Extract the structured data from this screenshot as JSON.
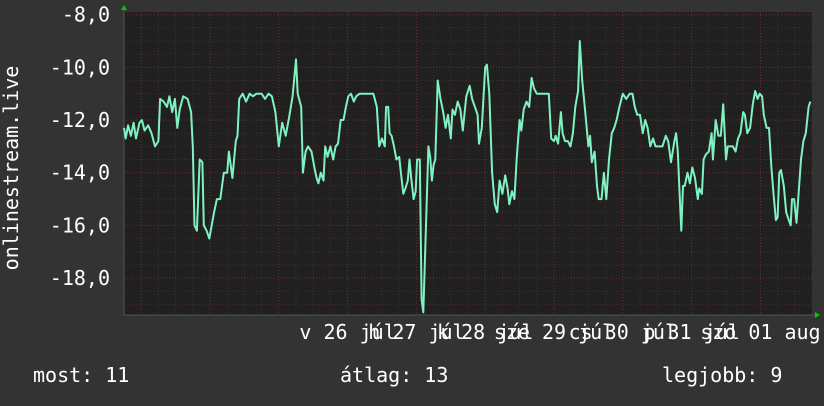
{
  "chart_data": {
    "type": "line",
    "ylabel": "onlinestream.live",
    "ylim": [
      -19.4,
      -7.9
    ],
    "y_ticks": [
      {
        "value": -8.0,
        "label": "-8,0"
      },
      {
        "value": -10.0,
        "label": "-10,0"
      },
      {
        "value": -12.0,
        "label": "-12,0"
      },
      {
        "value": -14.0,
        "label": "-14,0"
      },
      {
        "value": -16.0,
        "label": "-16,0"
      },
      {
        "value": -18.0,
        "label": "-18,0"
      }
    ],
    "x_tick_labels": [
      {
        "text": "v 26 júl",
        "x": 6.5
      },
      {
        "text": "h 27 júl",
        "x": 8.5
      },
      {
        "text": "k 28 júl",
        "x": 10.5
      },
      {
        "text": "sze 29 júl",
        "x": 12.5
      },
      {
        "text": "cs 30 júl",
        "x": 14.5
      },
      {
        "text": "p 31 júl",
        "x": 16.5
      },
      {
        "text": "szo 01 aug",
        "x": 18.5
      }
    ],
    "x_range": [
      0,
      20
    ],
    "grid": true,
    "colors": {
      "background": "#333333",
      "plot_bg": "#202020",
      "line": "#7ff2c2",
      "grid_minor": "#4a2a2a",
      "grid_major": "#6a2f2f",
      "axis_arrow": "#00cc00",
      "text": "#ffffff"
    },
    "series": [
      {
        "values": [
          [
            0.0,
            -12.3
          ],
          [
            0.05,
            -12.7
          ],
          [
            0.12,
            -12.2
          ],
          [
            0.2,
            -12.6
          ],
          [
            0.28,
            -12.1
          ],
          [
            0.35,
            -12.7
          ],
          [
            0.45,
            -12.1
          ],
          [
            0.52,
            -12.0
          ],
          [
            0.6,
            -12.4
          ],
          [
            0.7,
            -12.2
          ],
          [
            0.8,
            -12.5
          ],
          [
            0.9,
            -13.0
          ],
          [
            1.0,
            -12.8
          ],
          [
            1.05,
            -11.2
          ],
          [
            1.15,
            -11.3
          ],
          [
            1.25,
            -11.5
          ],
          [
            1.32,
            -11.1
          ],
          [
            1.4,
            -11.7
          ],
          [
            1.48,
            -11.2
          ],
          [
            1.55,
            -12.3
          ],
          [
            1.62,
            -11.6
          ],
          [
            1.72,
            -11.1
          ],
          [
            1.85,
            -11.2
          ],
          [
            1.95,
            -11.7
          ],
          [
            2.0,
            -13.0
          ],
          [
            2.05,
            -16.0
          ],
          [
            2.12,
            -16.2
          ],
          [
            2.2,
            -13.5
          ],
          [
            2.28,
            -13.6
          ],
          [
            2.32,
            -16.0
          ],
          [
            2.4,
            -16.2
          ],
          [
            2.48,
            -16.5
          ],
          [
            2.55,
            -16.0
          ],
          [
            2.62,
            -15.5
          ],
          [
            2.7,
            -15.0
          ],
          [
            2.8,
            -15.0
          ],
          [
            2.9,
            -14.0
          ],
          [
            3.0,
            -14.0
          ],
          [
            3.05,
            -13.2
          ],
          [
            3.15,
            -14.2
          ],
          [
            3.25,
            -12.8
          ],
          [
            3.3,
            -12.6
          ],
          [
            3.35,
            -11.2
          ],
          [
            3.45,
            -11.0
          ],
          [
            3.55,
            -11.3
          ],
          [
            3.65,
            -11.0
          ],
          [
            3.75,
            -11.1
          ],
          [
            3.85,
            -11.0
          ],
          [
            4.0,
            -11.0
          ],
          [
            4.1,
            -11.2
          ],
          [
            4.2,
            -11.0
          ],
          [
            4.3,
            -11.1
          ],
          [
            4.4,
            -11.7
          ],
          [
            4.5,
            -13.0
          ],
          [
            4.6,
            -12.1
          ],
          [
            4.7,
            -12.6
          ],
          [
            4.8,
            -11.9
          ],
          [
            4.9,
            -11.1
          ],
          [
            5.0,
            -9.7
          ],
          [
            5.05,
            -11.0
          ],
          [
            5.15,
            -11.5
          ],
          [
            5.2,
            -14.0
          ],
          [
            5.28,
            -13.2
          ],
          [
            5.35,
            -13.0
          ],
          [
            5.45,
            -13.2
          ],
          [
            5.55,
            -13.9
          ],
          [
            5.6,
            -14.2
          ],
          [
            5.65,
            -14.4
          ],
          [
            5.72,
            -14.0
          ],
          [
            5.8,
            -14.3
          ],
          [
            5.85,
            -13.0
          ],
          [
            5.92,
            -13.4
          ],
          [
            6.0,
            -13.0
          ],
          [
            6.08,
            -13.5
          ],
          [
            6.15,
            -13.0
          ],
          [
            6.22,
            -12.9
          ],
          [
            6.3,
            -12.0
          ],
          [
            6.38,
            -12.0
          ],
          [
            6.45,
            -11.5
          ],
          [
            6.52,
            -11.1
          ],
          [
            6.6,
            -11.0
          ],
          [
            6.68,
            -11.3
          ],
          [
            6.75,
            -11.1
          ],
          [
            6.85,
            -11.0
          ],
          [
            6.95,
            -11.0
          ],
          [
            7.05,
            -11.0
          ],
          [
            7.15,
            -11.0
          ],
          [
            7.25,
            -11.0
          ],
          [
            7.35,
            -11.5
          ],
          [
            7.42,
            -13.0
          ],
          [
            7.5,
            -12.7
          ],
          [
            7.58,
            -13.0
          ],
          [
            7.62,
            -11.5
          ],
          [
            7.68,
            -11.5
          ],
          [
            7.72,
            -12.5
          ],
          [
            7.78,
            -12.6
          ],
          [
            7.85,
            -13.0
          ],
          [
            7.92,
            -13.5
          ],
          [
            8.0,
            -13.4
          ],
          [
            8.05,
            -14.0
          ],
          [
            8.12,
            -14.8
          ],
          [
            8.18,
            -14.6
          ],
          [
            8.25,
            -14.3
          ],
          [
            8.3,
            -13.5
          ],
          [
            8.35,
            -14.2
          ],
          [
            8.42,
            -15.0
          ],
          [
            8.48,
            -14.7
          ],
          [
            8.52,
            -13.5
          ],
          [
            8.6,
            -13.5
          ],
          [
            8.65,
            -18.8
          ],
          [
            8.7,
            -19.3
          ],
          [
            8.78,
            -16.0
          ],
          [
            8.85,
            -13.0
          ],
          [
            8.9,
            -13.4
          ],
          [
            8.95,
            -14.3
          ],
          [
            9.0,
            -13.7
          ],
          [
            9.05,
            -13.5
          ],
          [
            9.12,
            -10.5
          ],
          [
            9.2,
            -11.2
          ],
          [
            9.28,
            -11.7
          ],
          [
            9.35,
            -12.3
          ],
          [
            9.42,
            -11.8
          ],
          [
            9.5,
            -12.7
          ],
          [
            9.55,
            -11.6
          ],
          [
            9.62,
            -11.8
          ],
          [
            9.7,
            -11.3
          ],
          [
            9.78,
            -11.6
          ],
          [
            9.85,
            -12.4
          ],
          [
            9.95,
            -11.1
          ],
          [
            10.05,
            -10.7
          ],
          [
            10.12,
            -11.2
          ],
          [
            10.2,
            -11.5
          ],
          [
            10.28,
            -11.8
          ],
          [
            10.32,
            -12.9
          ],
          [
            10.4,
            -12.3
          ],
          [
            10.5,
            -10.0
          ],
          [
            10.55,
            -9.9
          ],
          [
            10.62,
            -11.0
          ],
          [
            10.7,
            -14.0
          ],
          [
            10.78,
            -15.2
          ],
          [
            10.85,
            -15.5
          ],
          [
            10.92,
            -14.3
          ],
          [
            11.0,
            -14.8
          ],
          [
            11.08,
            -14.1
          ],
          [
            11.15,
            -14.6
          ],
          [
            11.2,
            -15.2
          ],
          [
            11.28,
            -14.7
          ],
          [
            11.35,
            -15.0
          ],
          [
            11.42,
            -13.4
          ],
          [
            11.5,
            -12.0
          ],
          [
            11.55,
            -12.4
          ],
          [
            11.62,
            -11.6
          ],
          [
            11.7,
            -11.3
          ],
          [
            11.78,
            -11.5
          ],
          [
            11.85,
            -10.4
          ],
          [
            11.92,
            -10.8
          ],
          [
            12.0,
            -11.0
          ],
          [
            12.1,
            -11.0
          ],
          [
            12.2,
            -11.0
          ],
          [
            12.3,
            -11.0
          ],
          [
            12.35,
            -11.0
          ],
          [
            12.42,
            -12.7
          ],
          [
            12.5,
            -12.8
          ],
          [
            12.55,
            -12.6
          ],
          [
            12.62,
            -12.9
          ],
          [
            12.7,
            -11.7
          ],
          [
            12.75,
            -12.5
          ],
          [
            12.82,
            -12.8
          ],
          [
            12.9,
            -12.8
          ],
          [
            12.98,
            -13.0
          ],
          [
            13.05,
            -12.5
          ],
          [
            13.12,
            -11.5
          ],
          [
            13.2,
            -10.9
          ],
          [
            13.25,
            -9.0
          ],
          [
            13.32,
            -10.5
          ],
          [
            13.4,
            -11.6
          ],
          [
            13.5,
            -13.0
          ],
          [
            13.55,
            -12.6
          ],
          [
            13.6,
            -13.6
          ],
          [
            13.68,
            -13.2
          ],
          [
            13.75,
            -14.5
          ],
          [
            13.8,
            -15.0
          ],
          [
            13.88,
            -15.0
          ],
          [
            13.95,
            -14.0
          ],
          [
            14.02,
            -15.0
          ],
          [
            14.1,
            -13.5
          ],
          [
            14.18,
            -12.5
          ],
          [
            14.25,
            -12.3
          ],
          [
            14.32,
            -12.0
          ],
          [
            14.4,
            -11.5
          ],
          [
            14.5,
            -11.0
          ],
          [
            14.6,
            -11.2
          ],
          [
            14.7,
            -11.0
          ],
          [
            14.78,
            -11.0
          ],
          [
            14.85,
            -11.5
          ],
          [
            14.92,
            -11.8
          ],
          [
            15.0,
            -11.8
          ],
          [
            15.08,
            -12.5
          ],
          [
            15.15,
            -12.0
          ],
          [
            15.22,
            -12.3
          ],
          [
            15.3,
            -13.0
          ],
          [
            15.38,
            -12.7
          ],
          [
            15.45,
            -13.0
          ],
          [
            15.55,
            -13.0
          ],
          [
            15.65,
            -13.0
          ],
          [
            15.75,
            -12.6
          ],
          [
            15.82,
            -12.8
          ],
          [
            15.9,
            -13.6
          ],
          [
            16.0,
            -12.8
          ],
          [
            16.05,
            -12.5
          ],
          [
            16.1,
            -13.2
          ],
          [
            16.15,
            -14.8
          ],
          [
            16.2,
            -16.2
          ],
          [
            16.25,
            -14.5
          ],
          [
            16.3,
            -14.5
          ],
          [
            16.38,
            -14.0
          ],
          [
            16.45,
            -14.4
          ],
          [
            16.52,
            -13.8
          ],
          [
            16.6,
            -14.2
          ],
          [
            16.68,
            -15.0
          ],
          [
            16.72,
            -14.6
          ],
          [
            16.8,
            -14.8
          ],
          [
            16.85,
            -13.5
          ],
          [
            16.92,
            -13.3
          ],
          [
            17.0,
            -13.2
          ],
          [
            17.08,
            -12.5
          ],
          [
            17.12,
            -13.5
          ],
          [
            17.2,
            -12.0
          ],
          [
            17.28,
            -12.6
          ],
          [
            17.35,
            -12.6
          ],
          [
            17.42,
            -11.4
          ],
          [
            17.5,
            -13.5
          ],
          [
            17.55,
            -13.0
          ],
          [
            17.62,
            -13.0
          ],
          [
            17.7,
            -13.0
          ],
          [
            17.78,
            -13.2
          ],
          [
            17.85,
            -12.7
          ],
          [
            17.92,
            -12.5
          ],
          [
            18.0,
            -11.7
          ],
          [
            18.05,
            -11.8
          ],
          [
            18.12,
            -12.5
          ],
          [
            18.2,
            -12.3
          ],
          [
            18.28,
            -11.4
          ],
          [
            18.35,
            -10.9
          ],
          [
            18.42,
            -11.2
          ],
          [
            18.48,
            -11.0
          ],
          [
            18.55,
            -11.1
          ],
          [
            18.6,
            -11.8
          ],
          [
            18.68,
            -12.3
          ],
          [
            18.75,
            -12.3
          ],
          [
            18.82,
            -13.8
          ],
          [
            18.88,
            -14.8
          ],
          [
            18.95,
            -15.8
          ],
          [
            19.0,
            -15.7
          ],
          [
            19.05,
            -14.0
          ],
          [
            19.1,
            -13.9
          ],
          [
            19.18,
            -14.5
          ],
          [
            19.25,
            -15.5
          ],
          [
            19.3,
            -15.7
          ],
          [
            19.38,
            -16.0
          ],
          [
            19.42,
            -15.0
          ],
          [
            19.48,
            -15.0
          ],
          [
            19.55,
            -15.9
          ],
          [
            19.6,
            -15.0
          ],
          [
            19.68,
            -13.5
          ],
          [
            19.75,
            -12.8
          ],
          [
            19.82,
            -12.5
          ],
          [
            19.9,
            -11.5
          ],
          [
            19.95,
            -11.3
          ]
        ]
      }
    ]
  },
  "footer": {
    "current": "most: 11",
    "average": "átlag: 13",
    "best": "legjobb: 9"
  }
}
